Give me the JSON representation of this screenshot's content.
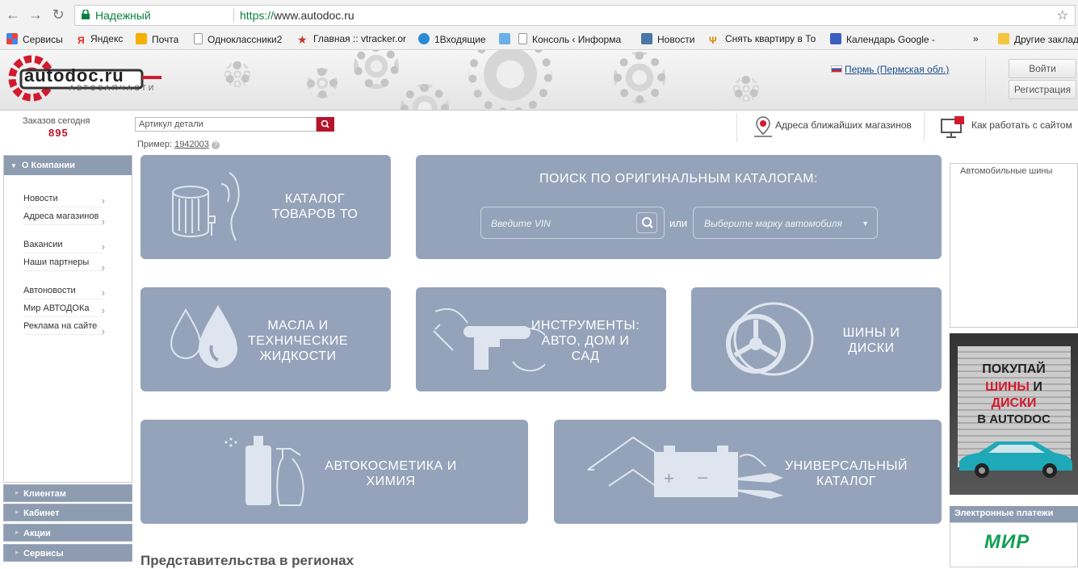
{
  "browser": {
    "security_label": "Надежный",
    "url_scheme": "https://",
    "url_host": "www.autodoc.ru",
    "bookmarks": [
      {
        "label": "Сервисы",
        "icon": "apps-grid-icon",
        "color": "#4285f4"
      },
      {
        "label": "Яндекс",
        "icon": "yandex-icon",
        "color": "#e52620"
      },
      {
        "label": "Почта",
        "icon": "mail-icon",
        "color": "#f6b000"
      },
      {
        "label": "Одноклассники2",
        "icon": "page-icon",
        "color": "#999999"
      },
      {
        "label": "Главная :: vtracker.or",
        "icon": "star-icon",
        "color": "#c0392b"
      },
      {
        "label": "1Входящие",
        "icon": "mail-icon",
        "color": "#2a8bd6"
      },
      {
        "label": "Консоль ‹ Информа",
        "icon": "page-icon",
        "color": "#999999"
      },
      {
        "label": "Новости",
        "icon": "vk-icon",
        "color": "#4a76a8"
      },
      {
        "label": "Снять квартиру в То",
        "icon": "trident-icon",
        "color": "#d08a00"
      },
      {
        "label": "Календарь Google -",
        "icon": "calendar-icon",
        "color": "#3b5fc0"
      },
      {
        "label": "»",
        "icon": "",
        "color": ""
      },
      {
        "label": "Другие заклад",
        "icon": "folder-icon",
        "color": "#f5c542"
      }
    ]
  },
  "header": {
    "logo_name": "autodoc.ru",
    "logo_tagline": "АВТОЗАПЧАСТИ",
    "city": "Пермь (Пермская обл.)",
    "login": "Войти",
    "register": "Регистрация"
  },
  "search_row": {
    "orders_label": "Заказов сегодня",
    "orders_count": "895",
    "article_placeholder": "Артикул детали",
    "example_label": "Пример:",
    "example_value": "1942003",
    "help": "?",
    "stores_link": "Адреса ближайших магазинов",
    "howto_link": "Как работать с сайтом"
  },
  "sidebar": {
    "header": "О Компании",
    "items": [
      {
        "label": "Новости"
      },
      {
        "label": "Адреса магазинов"
      },
      {
        "label": "Вакансии"
      },
      {
        "label": "Наши партнеры"
      },
      {
        "label": "Автоновости"
      },
      {
        "label": "Мир АВТОДОКа"
      },
      {
        "label": "Реклама на сайте"
      }
    ],
    "bottom": [
      "Клиентам",
      "Кабинет",
      "Акции",
      "Сервисы"
    ]
  },
  "tiles": {
    "to_catalog": "КАТАЛОГ ТОВАРОВ ТО",
    "original_search": {
      "title": "ПОИСК ПО ОРИГИНАЛЬНЫМ КАТАЛОГАМ:",
      "vin_placeholder": "Введите VIN",
      "or": "или",
      "brand_placeholder": "Выберите марку автомобиля"
    },
    "oils": "МАСЛА И ТЕХНИЧЕСКИЕ ЖИДКОСТИ",
    "tools": "ИНСТРУМЕНТЫ: АВТО, ДОМ И САД",
    "tires": "ШИНЫ И ДИСКИ",
    "cosmetics": "АВТОКОСМЕТИКА И ХИМИЯ",
    "universal": "УНИВЕРСАЛЬНЫЙ КАТАЛОГ"
  },
  "right": {
    "ad_title": "Автомобильные шины",
    "banner": {
      "line1": "ПОКУПАЙ",
      "line2a": "ШИНЫ",
      "line2b": "И",
      "line3": "ДИСКИ",
      "line4": "В AUTODOC"
    },
    "payments_header": "Электронные платежи",
    "payments_logo": "МИР"
  },
  "regions_heading": "Представительства в регионах",
  "colors": {
    "accent": "#b7132c",
    "tile": "#94a3b9",
    "sidebar_head": "#8e9cb1"
  }
}
